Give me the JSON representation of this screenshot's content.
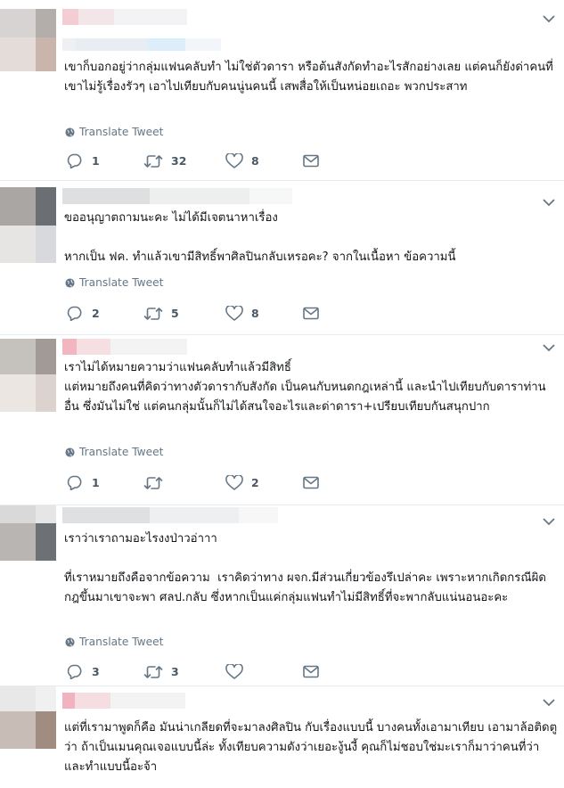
{
  "translate_label": "Translate Tweet",
  "colors": {
    "secondary": "#657786",
    "border": "#e6ecf0"
  },
  "tweets": [
    {
      "paragraphs": [
        "เขาก็บอกอยู่ว่ากลุ่มแฟนคลับทำ ไม่ใช่ตัวดารา หรือต้นสังกัดทำอะไรสักอย่างเลย แต่คนก็ยังด่าคนที่เขาไม่รู้เรื่องรัวๆ เอาไปเทียบกับคนนู่นคนนี้ เสพสื่อให้เป็นหน่อยเถอะ พวกประสาท"
      ],
      "replies": "1",
      "retweets": "32",
      "likes": "8"
    },
    {
      "paragraphs": [
        "ขออนุญาตถามนะคะ ไม่ได้มีเจตนาหาเรื่อง",
        "หากเป็น ฟค. ทำแล้วเขามีสิทธิ์พาศิลปินกลับเหรอคะ? จากในเนื้อหา ข้อความนี้"
      ],
      "replies": "2",
      "retweets": "5",
      "likes": "8"
    },
    {
      "paragraphs": [
        "เราไม่ได้หมายความว่าแฟนคลับทำแล้วมีสิทธิ์\nแต่หมายถึงคนที่คิดว่าทางตัวดารากับสังกัด เป็นคนกับหนดกฎเหล่านี้ และนำไปเทียบกับดาราท่านอื่น ซึ่งมันไม่ใช่ แต่คนกลุ่มนั้นก็ไม่ได้สนใจอะไรและด่าดารา+เปรียบเทียบกันสนุกปาก"
      ],
      "replies": "1",
      "retweets": "",
      "likes": "2"
    },
    {
      "paragraphs": [
        "เราว่าเราถามอะไรงงป่าวอ่าาา",
        "ที่เราหมายถึงคือจากข้อความ  เราคิดว่าทาง ผจก.มีส่วนเกี่ยวข้องรึเปล่าคะ เพราะหากเกิดกรณีผิดกฎขึ้นมาเขาจะพา ศลป.กลับ ซึ่งหากเป็นแค่กลุ่มแฟนทำไม่มีสิทธิ์ที่จะพากลับแน่นอนอะคะ"
      ],
      "replies": "3",
      "retweets": "3",
      "likes": ""
    },
    {
      "paragraphs": [
        "แต่ที่เรามาพูดก็คือ มันน่าเกลียดที่จะมาลงศิลปิน กับเรื่องแบบนี้ บางคนทั้งเอามาเทียบ เอามาล้อติดตูว่า ถ้าเป็นเมนคุณเจอแบบนี้ล่ะ ทั้งเทียบความดังว่าเยอะงู้นงี้ คุณก็ไม่ชอบใช่มะเราก็มาว่าคนที่ว่าและทำแบบนี้อะจ้า"
      ]
    }
  ]
}
